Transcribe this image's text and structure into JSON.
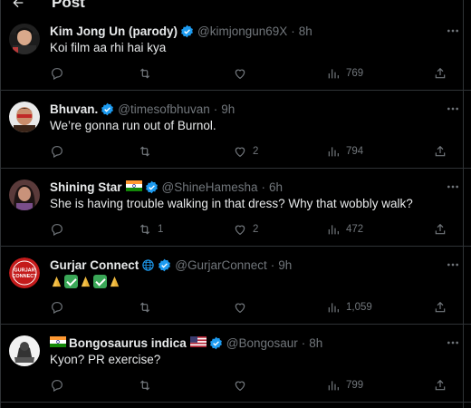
{
  "header": {
    "title": "Post"
  },
  "colors": {
    "accent": "#1d9bf0",
    "muted": "#71767b",
    "divider": "#2f3336"
  },
  "tweets": [
    {
      "name": "Kim Jong Un (parody)",
      "handle": "@kimjongun69X",
      "time": "8h",
      "text": "Koi film aa rhi hai kya",
      "replies": "",
      "retweets": "",
      "likes": "",
      "views": "769"
    },
    {
      "name": "Bhuvan.",
      "handle": "@timesofbhuvan",
      "time": "9h",
      "text": "We’re gonna run out of Burnol.",
      "replies": "",
      "retweets": "",
      "likes": "2",
      "views": "794"
    },
    {
      "name": "Shining Star",
      "name_flag": "🇮🇳",
      "handle": "@ShineHamesha",
      "time": "6h",
      "text": "She is having trouble walking in that dress? Why that wobbly walk?",
      "replies": "",
      "retweets": "1",
      "likes": "2",
      "views": "472"
    },
    {
      "name": "Gurjar Connect",
      "name_icon": "globe-icon",
      "handle": "@GurjarConnect",
      "time": "9h",
      "avatar_text_1": "GURJAR",
      "avatar_text_2": "CONNECT",
      "text_emojis": [
        "folded-hands",
        "check-box",
        "folded-hands",
        "check-box",
        "folded-hands"
      ],
      "replies": "",
      "retweets": "",
      "likes": "",
      "views": "1,059"
    },
    {
      "name": "Bongosaurus indica",
      "name_flag_before": "🇮🇳",
      "name_flag_after": "🇺🇸",
      "handle": "@Bongosaur",
      "time": "8h",
      "text": "Kyon? PR exercise?",
      "replies": "",
      "retweets": "",
      "likes": "",
      "views": "799"
    }
  ]
}
